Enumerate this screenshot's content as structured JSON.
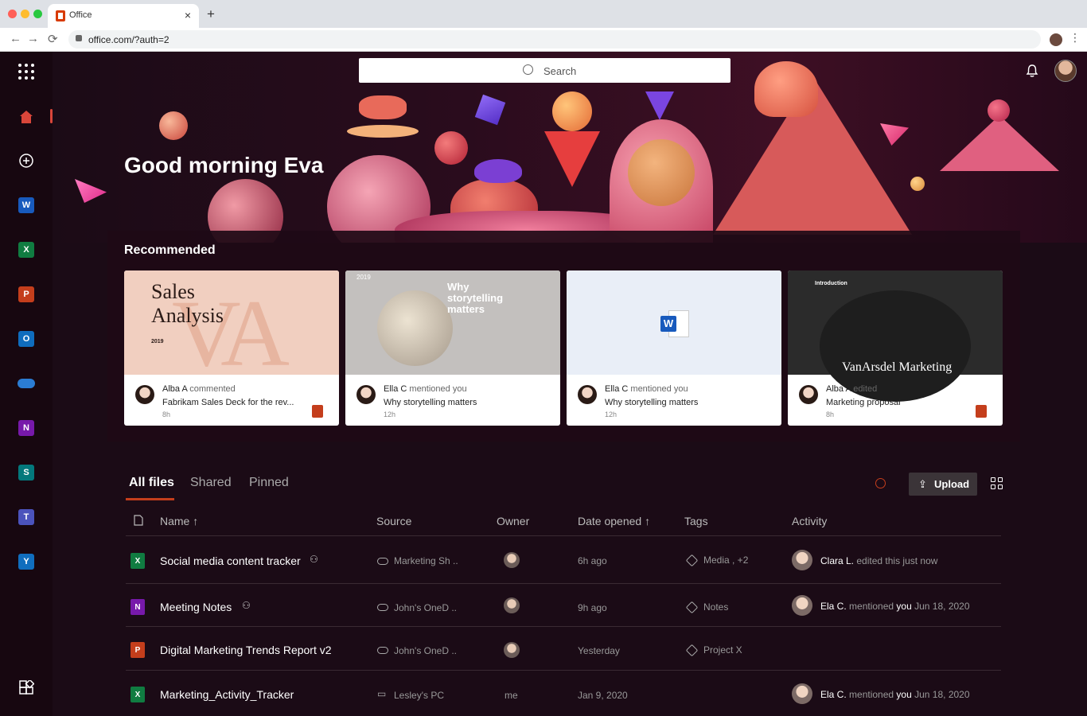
{
  "browser": {
    "tab_title": "Office",
    "url": "office.com/?auth=2",
    "new_tab_symbol": "+",
    "close_symbol": "×",
    "back_symbol": "←",
    "forward_symbol": "→",
    "reload_symbol": "⟳",
    "menu_symbol": "⋮"
  },
  "rail": {
    "apps": [
      {
        "name": "word",
        "letter": "W",
        "color": "#185abd"
      },
      {
        "name": "excel",
        "letter": "X",
        "color": "#107c41"
      },
      {
        "name": "powerpoint",
        "letter": "P",
        "color": "#c43e1c"
      },
      {
        "name": "outlook",
        "letter": "O",
        "color": "#0f6cbd"
      },
      {
        "name": "onedrive",
        "letter": "",
        "color": "#2b7cd3"
      },
      {
        "name": "onenote",
        "letter": "N",
        "color": "#7719aa"
      },
      {
        "name": "sharepoint",
        "letter": "S",
        "color": "#03787c"
      },
      {
        "name": "teams",
        "letter": "T",
        "color": "#4b53bc"
      },
      {
        "name": "yammer",
        "letter": "Y",
        "color": "#106ebe"
      }
    ]
  },
  "header": {
    "search_placeholder": "Search",
    "greeting": "Good morning Eva"
  },
  "recommended": {
    "title": "Recommended",
    "cards": [
      {
        "thumb_title": "Sales Analysis",
        "thumb_title_line1": "Sales",
        "thumb_title_line2": "Analysis",
        "thumb_year": "2019",
        "person": "Alba A",
        "action": "commented",
        "file": "Fabrikam Sales Deck for the rev...",
        "time": "8h"
      },
      {
        "thumb_title": "Why storytelling matters",
        "thumb_year": "2019",
        "person": "Ella C",
        "action": "mentioned you",
        "file": "Why storytelling matters",
        "time": "12h"
      },
      {
        "thumb_title": "",
        "person": "Ella C",
        "action": "mentioned you",
        "file": "Why storytelling matters",
        "time": "12h"
      },
      {
        "thumb_title": "VanArsdel Marketing",
        "thumb_heading": "Introduction",
        "person": "Alba A",
        "action": "edited",
        "file": "Marketing proposal",
        "time": "8h"
      }
    ]
  },
  "files": {
    "tabs": [
      "All files",
      "Shared",
      "Pinned"
    ],
    "upload_label": "Upload",
    "columns": [
      "Name",
      "Source",
      "Owner",
      "Date opened",
      "Tags",
      "Activity"
    ],
    "sort_arrow": "↑",
    "rows": [
      {
        "name": "Social media content tracker",
        "type": "excel",
        "shared": true,
        "source": "Marketing Sh ..",
        "owner": "",
        "date": "6h ago",
        "tags": "Media , +2",
        "activity_person": "Clara L.",
        "activity_text": "edited this just now",
        "activity_you": "",
        "activity_date": ""
      },
      {
        "name": "Meeting Notes",
        "type": "onenote",
        "shared": true,
        "source": "John's OneD ..",
        "owner": "",
        "date": "9h ago",
        "tags": "Notes",
        "activity_person": "Ela C.",
        "activity_text": "mentioned",
        "activity_you": "you",
        "activity_date": "Jun 18, 2020"
      },
      {
        "name": "Digital Marketing Trends Report v2",
        "type": "powerpoint",
        "shared": false,
        "source": "John's OneD ..",
        "owner": "",
        "date": "Yesterday",
        "tags": "Project X",
        "activity_person": "",
        "activity_text": "",
        "activity_you": "",
        "activity_date": ""
      },
      {
        "name": "Marketing_Activity_Tracker",
        "type": "excel",
        "shared": false,
        "source": "Lesley's PC",
        "owner": "me",
        "date": "Jan 9, 2020",
        "tags": "",
        "activity_person": "Ela C.",
        "activity_text": "mentioned",
        "activity_you": "you",
        "activity_date": "Jun 18, 2020"
      }
    ]
  },
  "colors": {
    "accent": "#c43e1c",
    "background": "#1b0b16"
  }
}
